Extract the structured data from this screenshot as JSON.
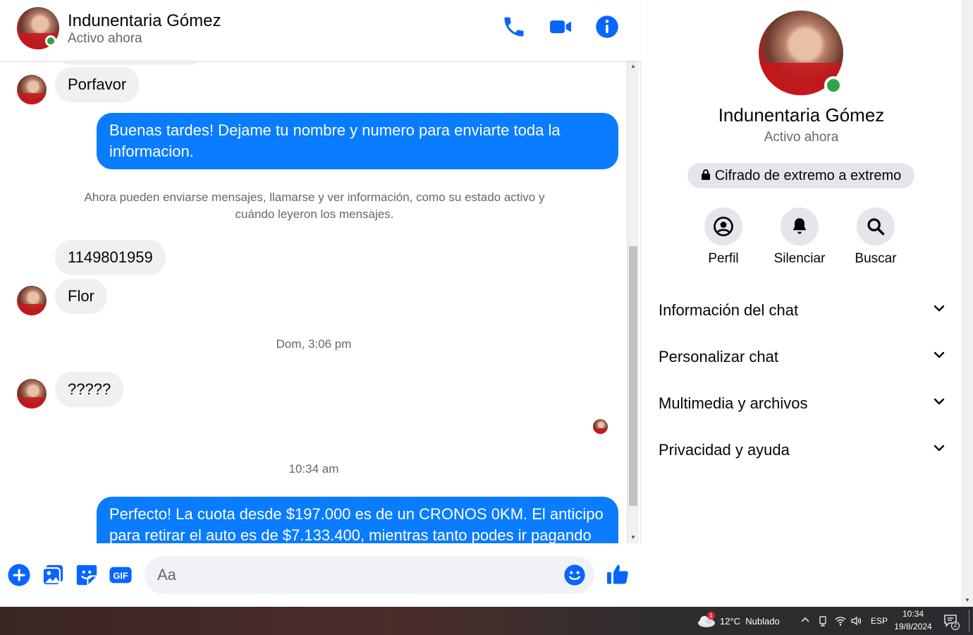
{
  "contact": {
    "name": "Indunentaria Gómez",
    "status": "Activo ahora"
  },
  "messages": {
    "porfavor": "Porfavor",
    "out1": "Buenas tardes! Dejame tu nombre y numero para enviarte toda la informacion.",
    "system": "Ahora pueden enviarse mensajes, llamarse y ver información, como su estado activo y cuándo leyeron los mensajes.",
    "phone": "1149801959",
    "flor": "Flor",
    "sep1": "Dom, 3:06 pm",
    "question": "?????",
    "sep2": "10:34 am",
    "out2": "Perfecto! La cuota desde $197.000 es de un CRONOS 0KM. El anticipo para retirar el auto es de $7.133.400, mientras tanto podes ir pagando"
  },
  "composer": {
    "placeholder": "Aa"
  },
  "side": {
    "e2e": "Cifrado de extremo a extremo",
    "actions": {
      "profile": "Perfil",
      "mute": "Silenciar",
      "search": "Buscar"
    },
    "sections": {
      "info": "Información del chat",
      "customize": "Personalizar chat",
      "media": "Multimedia y archivos",
      "privacy": "Privacidad y ayuda"
    }
  },
  "taskbar": {
    "weather": "12°C  Nublado",
    "weather_badge": "1",
    "lang": "ESP",
    "time": "10:34",
    "date": "19/8/2024",
    "notifications": "2"
  },
  "colors": {
    "accent": "#0a7cff",
    "online": "#31a24c",
    "icon_blue": "#0866ff"
  }
}
